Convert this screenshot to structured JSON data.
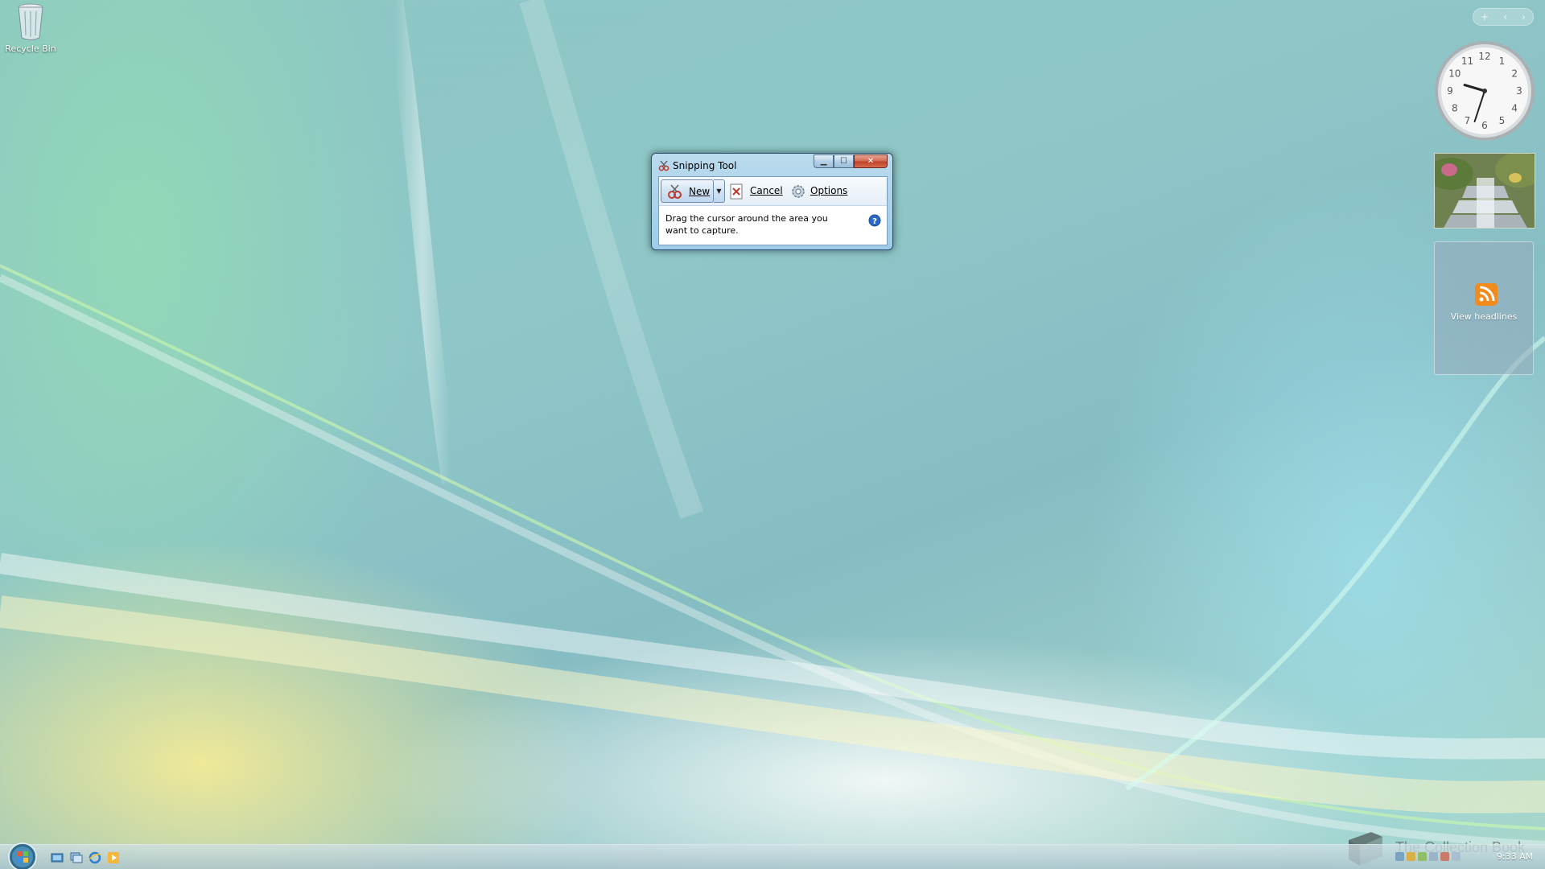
{
  "desktop": {
    "icons": [
      {
        "label": "Recycle Bin",
        "icon": "recycle-bin-icon"
      }
    ]
  },
  "snipping_tool": {
    "title": "Snipping Tool",
    "toolbar": {
      "new_label": "New",
      "cancel_label": "Cancel",
      "options_label": "Options"
    },
    "message": "Drag the cursor around the area you want to capture.",
    "caption_buttons": [
      "minimize",
      "maximize",
      "close"
    ]
  },
  "sidebar": {
    "clock": {
      "hour": 9,
      "minute": 33,
      "numerals": [
        "12",
        "1",
        "2",
        "3",
        "4",
        "5",
        "6",
        "7",
        "8",
        "9",
        "10",
        "11"
      ]
    },
    "feed": {
      "label": "View headlines",
      "icon": "rss-icon"
    },
    "controls": [
      "+",
      "‹",
      "›"
    ]
  },
  "taskbar": {
    "time": "9:33 AM",
    "quick_launch": [
      "show-desktop-icon",
      "switch-windows-icon",
      "internet-explorer-icon",
      "media-player-icon"
    ]
  },
  "watermark": {
    "text": "The Collection Book"
  },
  "colors": {
    "title_bar": "#b5d6ee",
    "close_button": "#c0422a",
    "rss": "#f28a1c",
    "help": "#2a68c9"
  }
}
